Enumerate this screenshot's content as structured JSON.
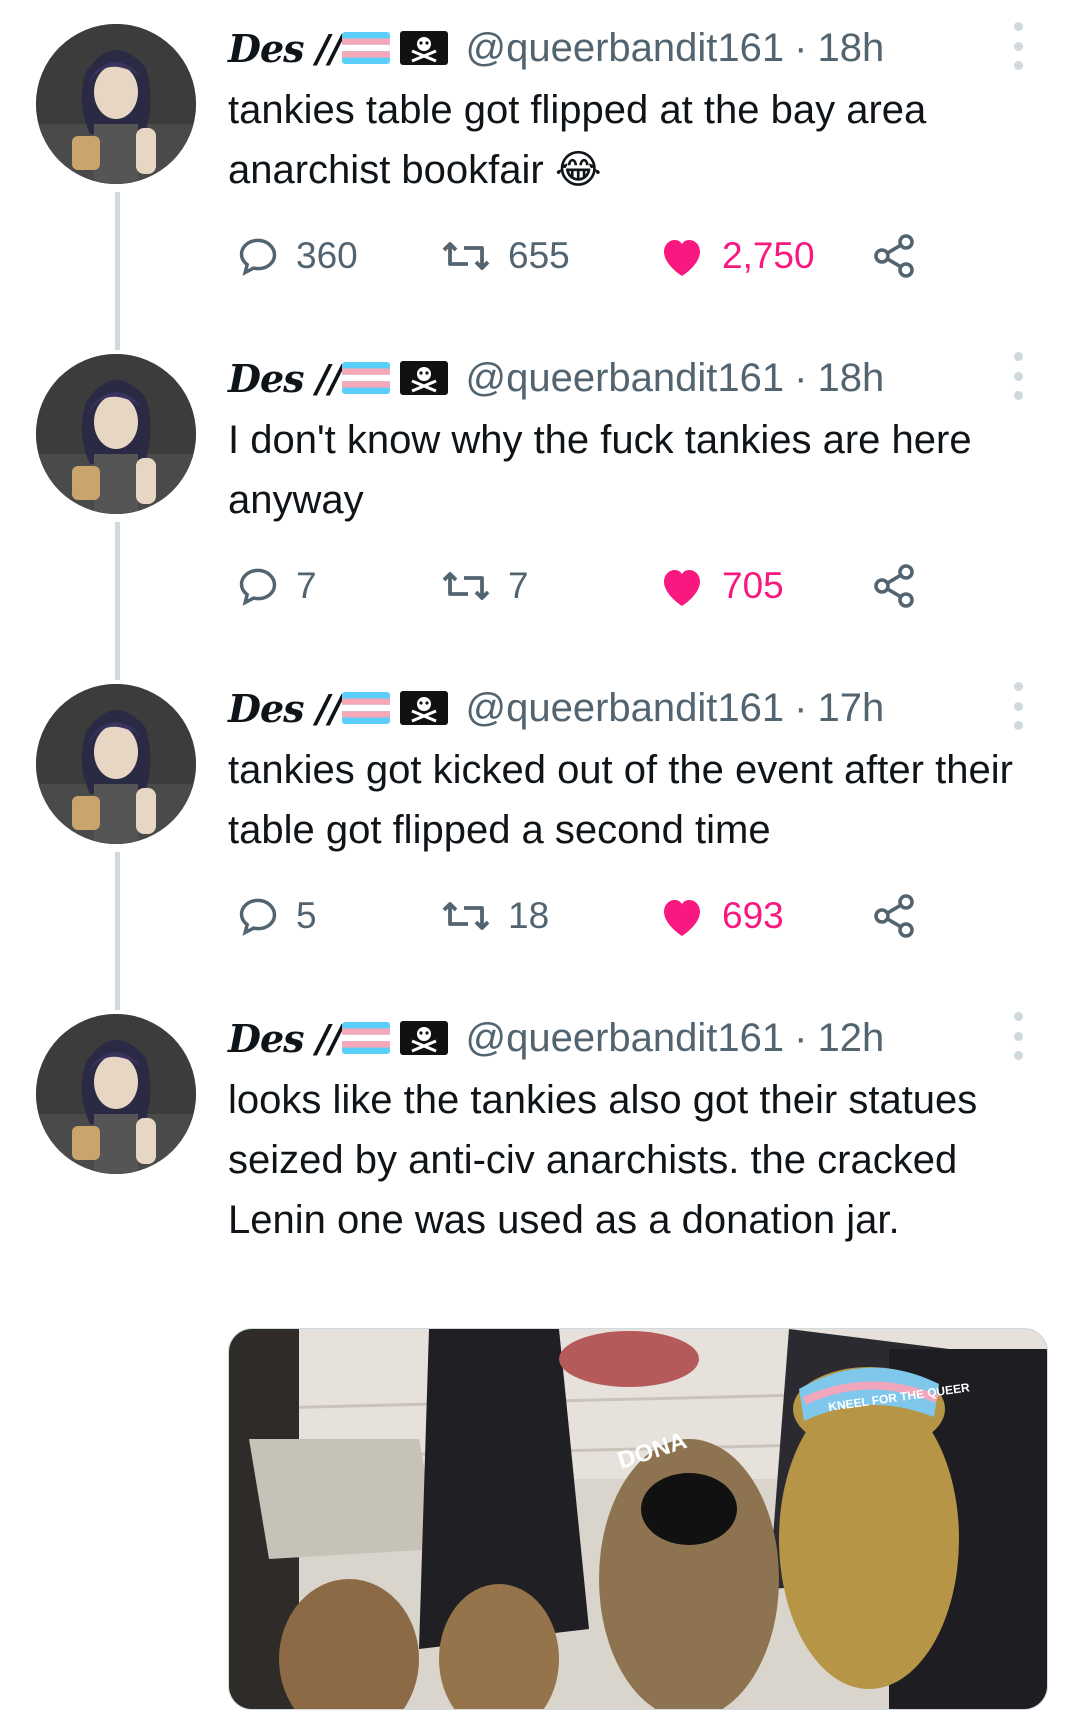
{
  "author": {
    "display_name": "Des //",
    "handle": "@queerbandit161"
  },
  "tweets": [
    {
      "time": "18h",
      "text": "tankies table got flipped at the bay area anarchist bookfair 😂",
      "replies": "360",
      "retweets": "655",
      "likes": "2,750"
    },
    {
      "time": "18h",
      "text": "I don't know why the fuck tankies are here anyway",
      "replies": "7",
      "retweets": "7",
      "likes": "705"
    },
    {
      "time": "17h",
      "text": "tankies got kicked out of the event after their table got flipped a second time",
      "replies": "5",
      "retweets": "18",
      "likes": "693"
    },
    {
      "time": "12h",
      "text": "looks like the tankies also got their statues seized by anti-civ anarchists. the cracked Lenin one was used as a donation jar."
    }
  ],
  "photo": {
    "sign_text": "DONA",
    "sticker_text": "KNEEL FOR THE QUEER"
  },
  "icons": {
    "reply": "reply-icon",
    "retweet": "retweet-icon",
    "like": "heart-icon",
    "share": "share-icon",
    "more": "more-icon",
    "flag": "trans-flag-icon",
    "pirate": "pirate-flag-icon"
  },
  "colors": {
    "like": "#f91880",
    "muted": "#536471",
    "thread_line": "#cfd9de",
    "flag_blue": "#5BCEFA",
    "flag_pink": "#F5A9B8"
  }
}
